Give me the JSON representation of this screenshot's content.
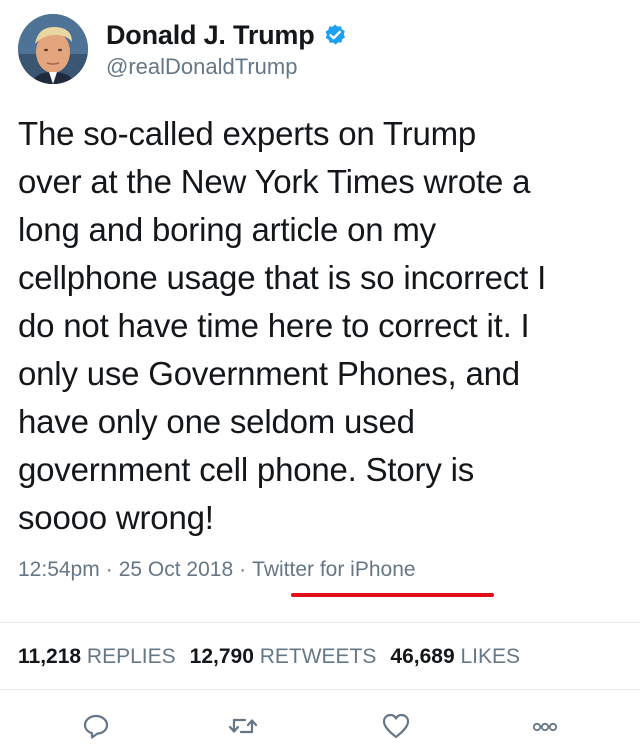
{
  "author": {
    "display_name": "Donald J. Trump",
    "handle": "@realDonaldTrump",
    "verified": true,
    "avatar_icon": "profile-photo"
  },
  "tweet": {
    "lines": [
      "The so-called experts on Trump",
      "over at the New York Times wrote a",
      "long and boring article on my",
      "cellphone usage that is so incorrect I",
      "do not have time here to correct it. I",
      "only use Government Phones, and",
      "have only one seldom used",
      "government cell phone. Story is",
      "soooo wrong!"
    ]
  },
  "meta": {
    "time": "12:54pm",
    "separator": "·",
    "date": "25 Oct 2018",
    "source": "Twitter for iPhone"
  },
  "stats": {
    "replies_count": "11,218",
    "replies_label": "REPLIES",
    "retweets_count": "12,790",
    "retweets_label": "RETWEETS",
    "likes_count": "46,689",
    "likes_label": "LIKES"
  },
  "actions": {
    "reply_icon": "reply-icon",
    "retweet_icon": "retweet-icon",
    "like_icon": "heart-icon",
    "more_icon": "more-icon"
  },
  "colors": {
    "text": "#14171a",
    "secondary": "#657786",
    "verified": "#1da1f2",
    "annotation": "#e0101a",
    "divider": "#e6ecf0"
  }
}
